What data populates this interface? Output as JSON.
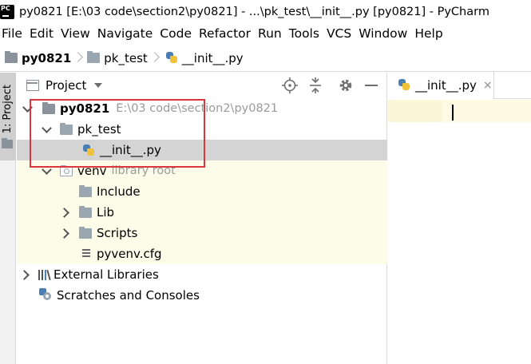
{
  "window": {
    "title": "py0821 [E:\\03 code\\section2\\py0821] - ...\\pk_test\\__init__.py [py0821] - PyCharm",
    "logo_icon": "pycharm-icon"
  },
  "menu": {
    "items": [
      "File",
      "Edit",
      "View",
      "Navigate",
      "Code",
      "Refactor",
      "Run",
      "Tools",
      "VCS",
      "Window",
      "Help"
    ]
  },
  "breadcrumb": {
    "items": [
      {
        "label": "py0821",
        "icon": "folder-icon"
      },
      {
        "label": "pk_test",
        "icon": "folder-icon"
      },
      {
        "label": "__init__.py",
        "icon": "python-file-icon"
      }
    ]
  },
  "stripe": {
    "project_tab_label": "1: Project"
  },
  "project_panel": {
    "title": "Project",
    "tools": [
      "locate-icon",
      "collapse-all-icon",
      "settings-gear-icon",
      "hide-icon"
    ],
    "tree": {
      "root_label": "py0821",
      "root_path": "E:\\03 code\\section2\\py0821",
      "pk_test": "pk_test",
      "init_file": "__init__.py",
      "venv": "venv",
      "venv_hint": "library root",
      "include": "Include",
      "lib": "Lib",
      "scripts": "Scripts",
      "pyvenv": "pyvenv.cfg",
      "external_libraries": "External Libraries",
      "scratches": "Scratches and Consoles"
    }
  },
  "editor": {
    "tab_label": "__init__.py",
    "tab_close": "×"
  },
  "colors": {
    "highlight_box": "#d9363e",
    "selection": "#d4d4d4",
    "library_root_bg": "#fcfce8",
    "current_line": "#fffae3"
  }
}
